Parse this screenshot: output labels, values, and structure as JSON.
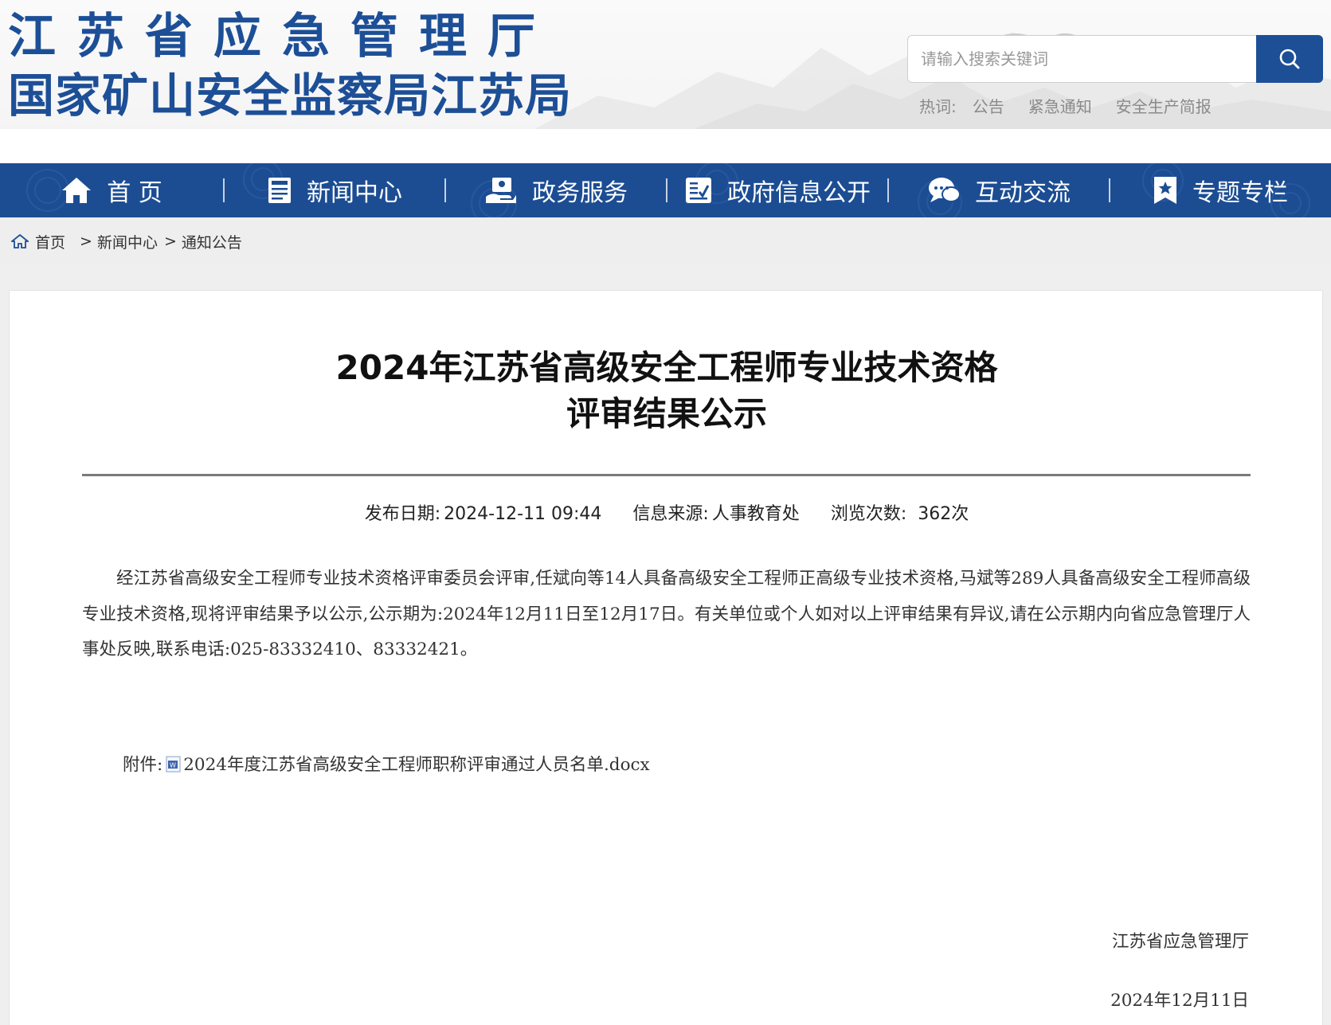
{
  "header": {
    "logo_line1": "江苏省应急管理厅",
    "logo_line2": "国家矿山安全监察局江苏局",
    "search_placeholder": "请输入搜索关键词",
    "hotwords_label": "热词:",
    "hotwords": [
      "公告",
      "紧急通知",
      "安全生产简报"
    ]
  },
  "nav": {
    "items": [
      {
        "label": "首 页",
        "icon": "home-icon"
      },
      {
        "label": "新闻中心",
        "icon": "news-icon"
      },
      {
        "label": "政务服务",
        "icon": "service-icon"
      },
      {
        "label": "政府信息公开",
        "icon": "info-disclosure-icon"
      },
      {
        "label": "互动交流",
        "icon": "chat-icon"
      },
      {
        "label": "专题专栏",
        "icon": "bookmark-star-icon"
      }
    ]
  },
  "breadcrumb": {
    "home": "首页",
    "level1": "新闻中心",
    "level2": "通知公告",
    "sep": ">"
  },
  "article": {
    "title_line1": "2024年江苏省高级安全工程师专业技术资格",
    "title_line2": "评审结果公示",
    "publish_label": "发布日期:",
    "publish_date": "2024-12-11 09:44",
    "source_label": "信息来源:",
    "source": "人事教育处",
    "views_label": "浏览次数:",
    "views": "362次",
    "body": "经江苏省高级安全工程师专业技术资格评审委员会评审,任斌向等14人具备高级安全工程师正高级专业技术资格,马斌等289人具备高级安全工程师高级专业技术资格,现将评审结果予以公示,公示期为:2024年12月11日至12月17日。有关单位或个人如对以上评审结果有异议,请在公示期内向省应急管理厅人事处反映,联系电话:025-83332410、83332421。",
    "attachment_label": "附件:",
    "attachment_name": "2024年度江苏省高级安全工程师职称评审通过人员名单.docx",
    "signature_org": "江苏省应急管理厅",
    "signature_date": "2024年12月11日"
  },
  "colors": {
    "brand_blue": "#1d4f97",
    "nav_blue": "#1c4d93"
  }
}
